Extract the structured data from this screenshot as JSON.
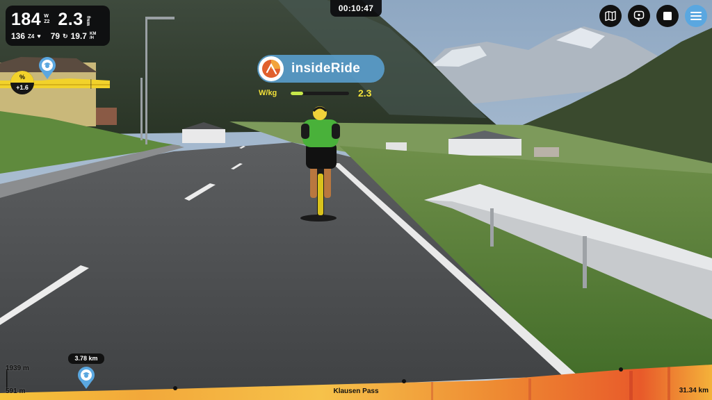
{
  "app": {
    "timer": "00:10:47"
  },
  "stats": {
    "power": "184",
    "power_zone": "Z2",
    "power_unit_top": "W",
    "wkg": "2.3",
    "wkg_unit": "W/kg",
    "heart_rate": "136",
    "hr_zone": "Z4",
    "cadence": "79",
    "speed": "19.7",
    "speed_unit_top": "KM",
    "speed_unit_bottom": "/H"
  },
  "grade": {
    "label": "%",
    "value": "+1.6"
  },
  "partner": {
    "name": "insideRide",
    "metric_label": "W/kg",
    "metric_value": "2.3",
    "metric_fill_fraction": 0.22
  },
  "controls": {
    "map_icon": "map-icon",
    "camera_icon": "camera-switch-icon",
    "stop_icon": "stop-icon",
    "menu_icon": "menu-icon"
  },
  "profile": {
    "max_elevation": "1939 m",
    "min_elevation": "591 m",
    "rider_distance": "3.78 km",
    "route_name": "Klausen Pass",
    "total_distance": "31.34 km"
  },
  "colors": {
    "accent_yellow": "#f2d22b",
    "menu_blue": "#5aa7e0",
    "partner_blue": "#5aa0d2",
    "wkg_fill": "#c6e84a"
  }
}
